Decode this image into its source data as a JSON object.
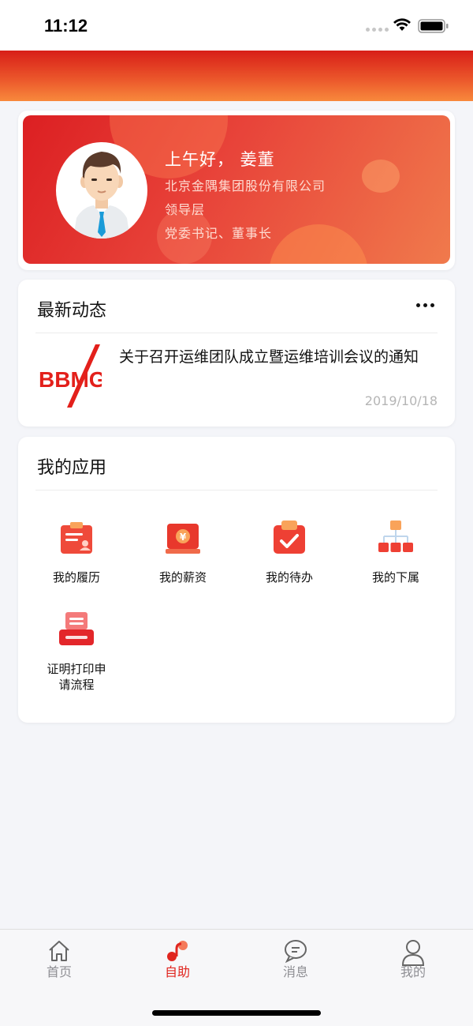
{
  "status_bar": {
    "time": "11:12"
  },
  "profile": {
    "greeting": "上午好， 姜董",
    "company": "北京金隅集团股份有限公司",
    "role": "领导层",
    "position": "党委书记、董事长"
  },
  "news": {
    "title": "最新动态",
    "items": [
      {
        "thumb_text": "BBMG",
        "title": "关于召开运维团队成立暨运维培训会议的通知",
        "date": "2019/10/18"
      }
    ]
  },
  "apps": {
    "title": "我的应用",
    "items": [
      {
        "label": "我的履历",
        "icon": "resume-icon"
      },
      {
        "label": "我的薪资",
        "icon": "salary-icon"
      },
      {
        "label": "我的待办",
        "icon": "todo-icon"
      },
      {
        "label": "我的下属",
        "icon": "subordinates-icon"
      },
      {
        "label": "证明打印申请流程",
        "icon": "printer-icon"
      }
    ]
  },
  "tabbar": {
    "items": [
      {
        "label": "首页",
        "icon": "home-icon",
        "active": false
      },
      {
        "label": "自助",
        "icon": "self-service-icon",
        "active": true
      },
      {
        "label": "消息",
        "icon": "message-icon",
        "active": false
      },
      {
        "label": "我的",
        "icon": "user-icon",
        "active": false
      }
    ]
  },
  "colors": {
    "accent": "#e0251f",
    "header_gradient_start": "#d81e18",
    "header_gradient_end": "#f8893c",
    "inactive": "#8e8e93"
  }
}
